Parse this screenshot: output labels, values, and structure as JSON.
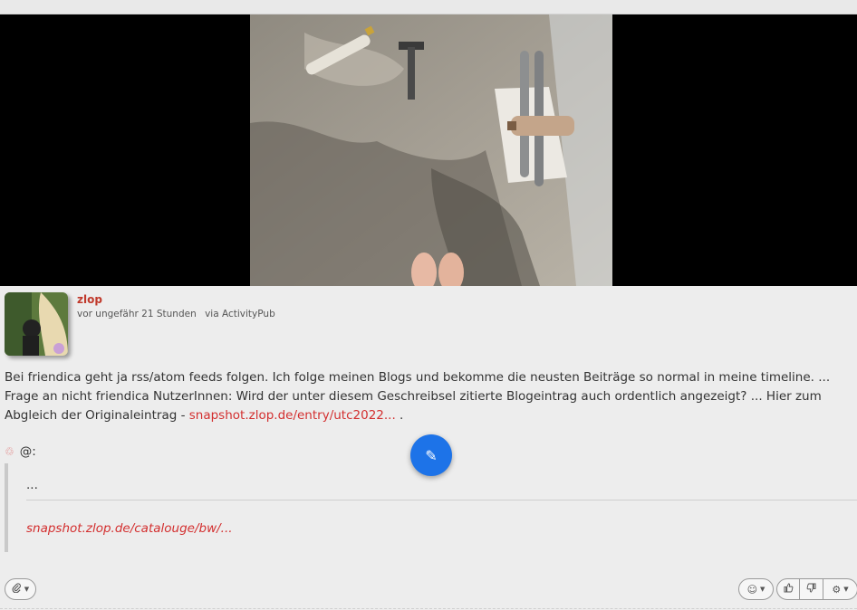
{
  "post": {
    "author": "zlop",
    "time": "vor ungefähr 21 Stunden",
    "via": "via ActivityPub",
    "body_text": "Bei friendica geht ja rss/atom feeds folgen. Ich folge meinen Blogs und bekomme die neusten Beiträge so normal in meine timeline. ... Frage an nicht friendica NutzerInnen: Wird der unter diesem Geschreibsel zitierte Blogeintrag auch ordentlich angezeigt? ... Hier zum Abgleich der Originaleintrag - ",
    "body_link": "snapshot.zlop.de/entry/utc2022...",
    "body_suffix": " .",
    "share_prefix": "@:",
    "quote_ellipsis": "...",
    "quote_link": "snapshot.zlop.de/catalouge/bw/..."
  },
  "icons": {
    "share": "share-icon",
    "compose": "pencil-icon",
    "attach": "paperclip-icon",
    "emoji": "smiley-icon",
    "like": "thumbs-up-icon",
    "dislike": "thumbs-down-icon",
    "settings": "gear-icon"
  },
  "colors": {
    "link": "#d32f2f",
    "fab": "#1d73e8",
    "background": "#ededed"
  }
}
